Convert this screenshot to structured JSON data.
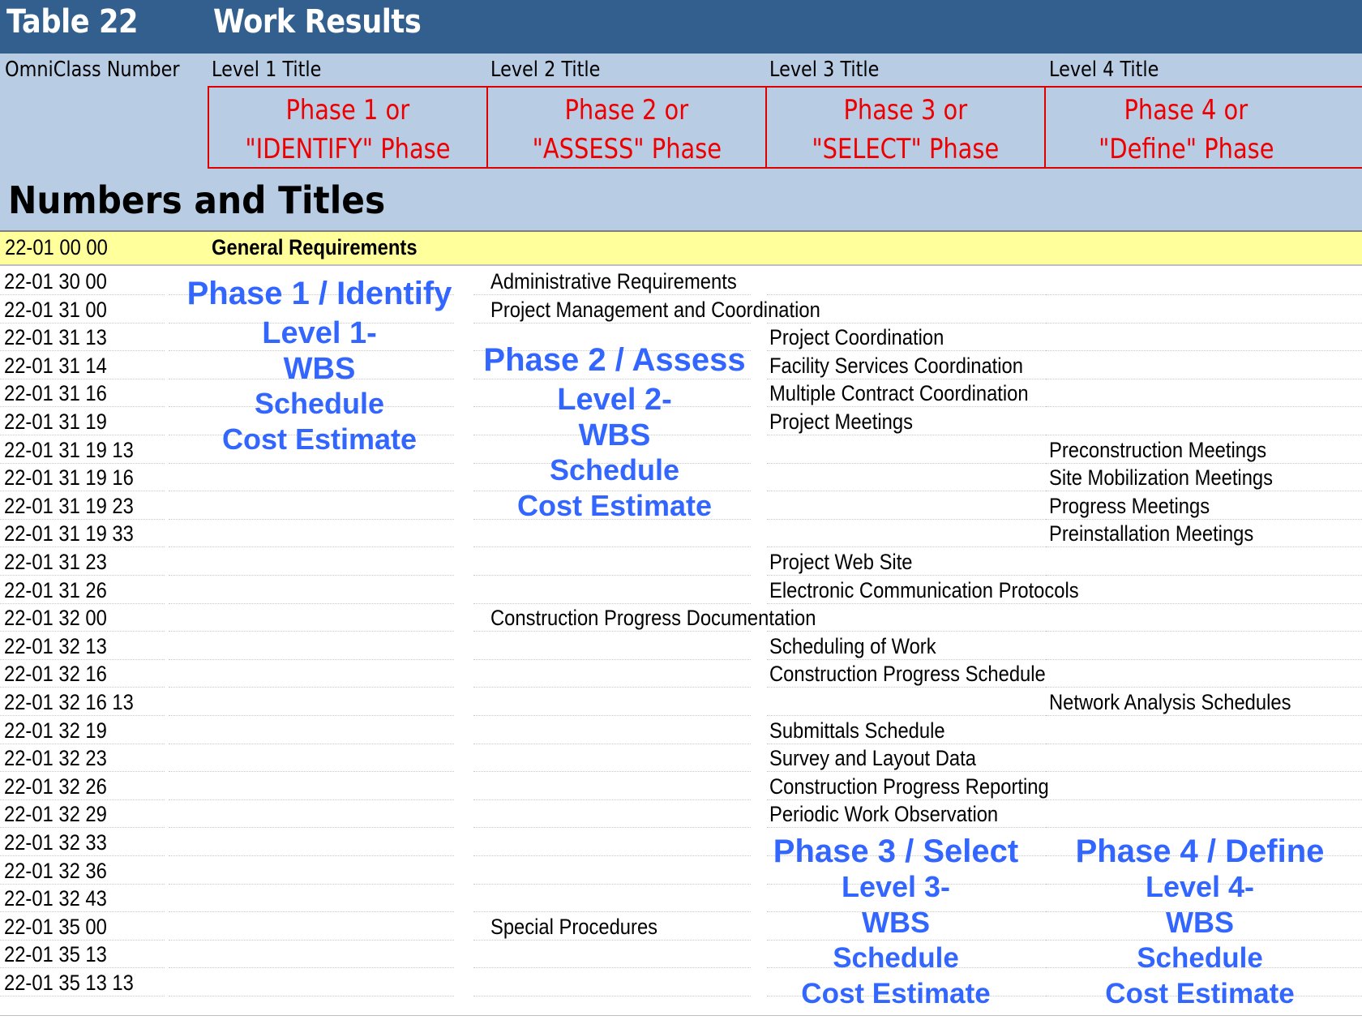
{
  "table": {
    "number": "Table 22",
    "name": "Work Results"
  },
  "columns": [
    "OmniClass Number",
    "Level 1 Title",
    "Level 2 Title",
    "Level 3 Title",
    "Level 4 Title"
  ],
  "phases": [
    {
      "line1": "Phase 1  or",
      "line2": "\"IDENTIFY\" Phase"
    },
    {
      "line1": "Phase 2 or",
      "line2": "\"ASSESS\" Phase"
    },
    {
      "line1": "Phase 3 or",
      "line2": "\"SELECT\" Phase"
    },
    {
      "line1": "Phase 4 or",
      "line2": "\"Define\" Phase"
    }
  ],
  "section_title": "Numbers and Titles",
  "general": {
    "number": "22-01 00 00",
    "title": "General Requirements"
  },
  "rows": [
    {
      "number": "22-01 30 00",
      "level": 2,
      "title": "Administrative Requirements"
    },
    {
      "number": "22-01 31 00",
      "level": 2,
      "title": "Project Management and Coordination"
    },
    {
      "number": "22-01 31 13",
      "level": 3,
      "title": "Project Coordination"
    },
    {
      "number": "22-01 31 14",
      "level": 3,
      "title": "Facility Services Coordination"
    },
    {
      "number": "22-01 31 16",
      "level": 3,
      "title": "Multiple Contract Coordination"
    },
    {
      "number": "22-01 31 19",
      "level": 3,
      "title": "Project Meetings"
    },
    {
      "number": "22-01 31 19 13",
      "level": 4,
      "title": "Preconstruction Meetings"
    },
    {
      "number": "22-01 31 19 16",
      "level": 4,
      "title": "Site Mobilization Meetings"
    },
    {
      "number": "22-01 31 19 23",
      "level": 4,
      "title": "Progress Meetings"
    },
    {
      "number": "22-01 31 19 33",
      "level": 4,
      "title": "Preinstallation Meetings"
    },
    {
      "number": "22-01 31 23",
      "level": 3,
      "title": "Project Web Site"
    },
    {
      "number": "22-01 31 26",
      "level": 3,
      "title": "Electronic Communication Protocols"
    },
    {
      "number": "22-01 32 00",
      "level": 2,
      "title": "Construction Progress Documentation"
    },
    {
      "number": "22-01 32 13",
      "level": 3,
      "title": "Scheduling of Work"
    },
    {
      "number": "22-01 32 16",
      "level": 3,
      "title": "Construction Progress Schedule"
    },
    {
      "number": "22-01 32 16 13",
      "level": 4,
      "title": "Network Analysis Schedules"
    },
    {
      "number": "22-01 32 19",
      "level": 3,
      "title": "Submittals Schedule"
    },
    {
      "number": "22-01 32 23",
      "level": 3,
      "title": "Survey and Layout Data"
    },
    {
      "number": "22-01 32 26",
      "level": 3,
      "title": "Construction Progress Reporting"
    },
    {
      "number": "22-01 32 29",
      "level": 3,
      "title": "Periodic Work Observation"
    },
    {
      "number": "22-01 32 33",
      "level": 3,
      "title": ""
    },
    {
      "number": "22-01 32 36",
      "level": 3,
      "title": ""
    },
    {
      "number": "22-01 32 43",
      "level": 3,
      "title": ""
    },
    {
      "number": "22-01 35 00",
      "level": 2,
      "title": "Special Procedures"
    },
    {
      "number": "22-01 35 13",
      "level": 3,
      "title": ""
    },
    {
      "number": "22-01 35 13 13",
      "level": 4,
      "title": ""
    }
  ],
  "overlays": [
    {
      "lines": [
        "Phase 1 / Identify",
        "Level 1-",
        "WBS",
        "Schedule",
        "Cost Estimate"
      ]
    },
    {
      "lines": [
        "Phase 2 / Assess",
        "Level 2-",
        "WBS",
        "Schedule",
        "Cost Estimate"
      ]
    },
    {
      "lines": [
        "Phase 3 / Select",
        "Level 3-",
        "WBS",
        "Schedule",
        "Cost Estimate"
      ]
    },
    {
      "lines": [
        "Phase 4 / Define",
        "Level 4-",
        "WBS",
        "Schedule",
        "Cost Estimate"
      ]
    }
  ],
  "colors": {
    "title_bar": "#335f8f",
    "header_band": "#b8cce4",
    "phase_text": "#ee0000",
    "general_row": "#ffff9b",
    "overlay_text": "#3366ff"
  }
}
